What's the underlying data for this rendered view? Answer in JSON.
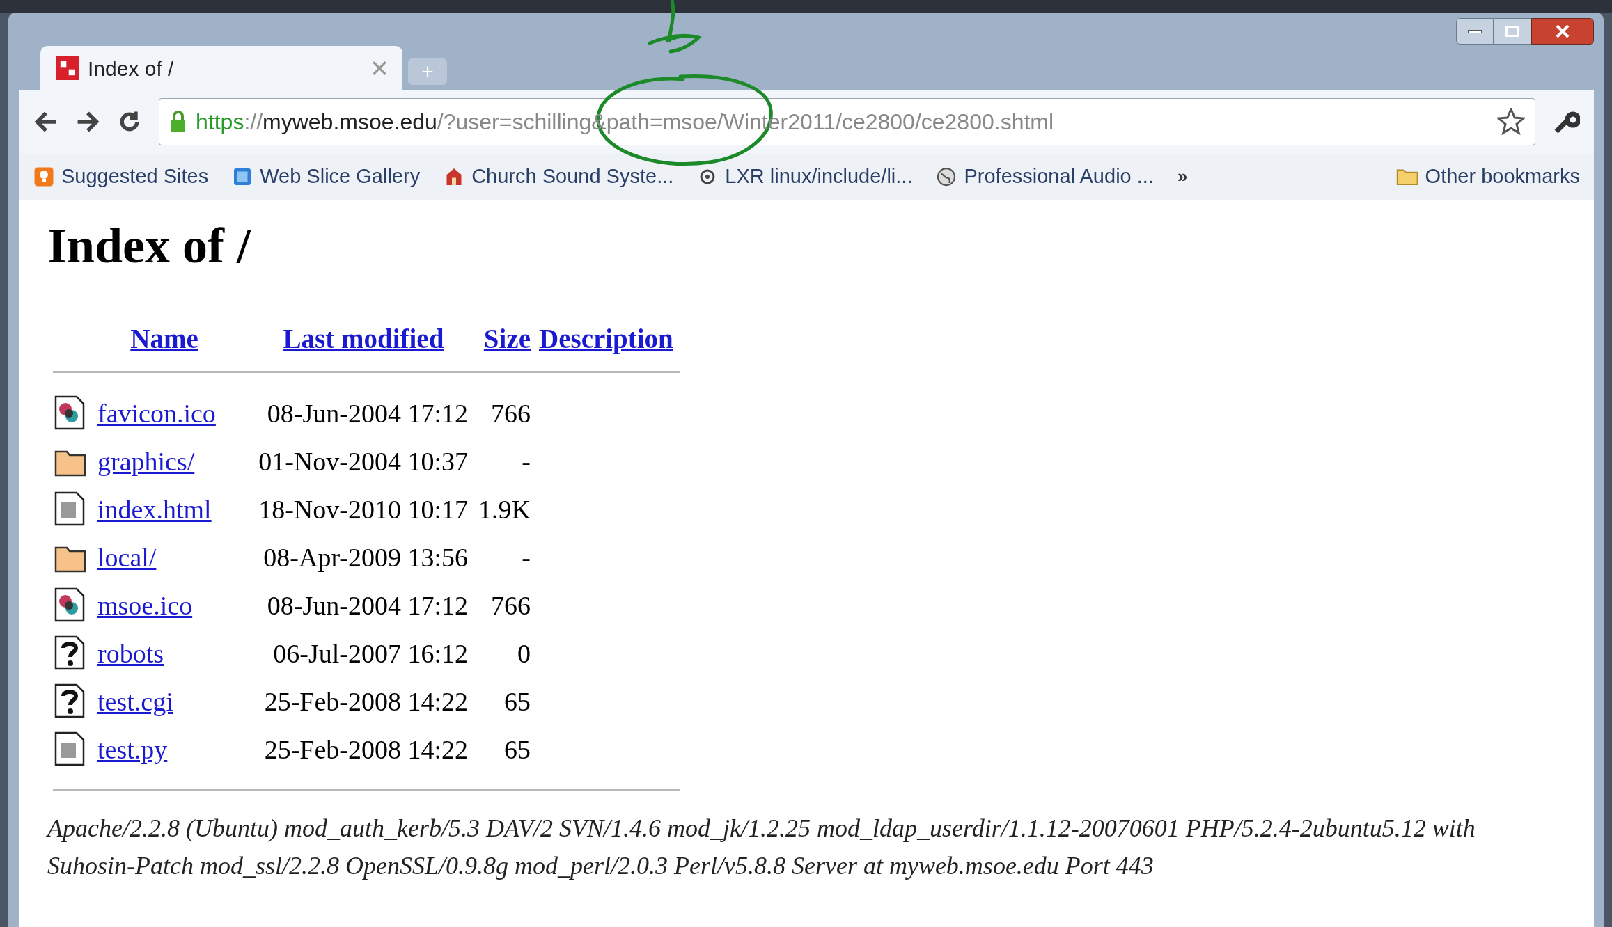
{
  "window": {
    "tabs": [
      {
        "title": "Index of /",
        "selected": true
      }
    ],
    "new_tab": "+"
  },
  "address_bar": {
    "scheme": "https",
    "separator": "://",
    "host": "myweb.msoe.edu",
    "path": "/?user=schilling&path=msoe/Winter2011/ce2800/ce2800.shtml"
  },
  "bookmarks": [
    {
      "kind": "bulb",
      "label": "Suggested Sites"
    },
    {
      "kind": "slice",
      "label": "Web Slice Gallery"
    },
    {
      "kind": "church",
      "label": "Church Sound Syste..."
    },
    {
      "kind": "lxr",
      "label": "LXR linux/include/li..."
    },
    {
      "kind": "globe",
      "label": "Professional Audio ..."
    }
  ],
  "bookmarks_overflow": "»",
  "other_bookmarks": "Other bookmarks",
  "page": {
    "heading": "Index of /",
    "columns": [
      "Name",
      "Last modified",
      "Size",
      "Description"
    ],
    "rows": [
      {
        "kind": "image",
        "name": "favicon.ico",
        "modified": "08-Jun-2004 17:12",
        "size": "766"
      },
      {
        "kind": "folder",
        "name": "graphics/",
        "modified": "01-Nov-2004 10:37",
        "size": "-"
      },
      {
        "kind": "text",
        "name": "index.html",
        "modified": "18-Nov-2010 10:17",
        "size": "1.9K"
      },
      {
        "kind": "folder",
        "name": "local/",
        "modified": "08-Apr-2009 13:56",
        "size": "-"
      },
      {
        "kind": "image",
        "name": "msoe.ico",
        "modified": "08-Jun-2004 17:12",
        "size": "766"
      },
      {
        "kind": "unknown",
        "name": "robots",
        "modified": "06-Jul-2007 16:12",
        "size": "0"
      },
      {
        "kind": "unknown",
        "name": "test.cgi",
        "modified": "25-Feb-2008 14:22",
        "size": "65"
      },
      {
        "kind": "text",
        "name": "test.py",
        "modified": "25-Feb-2008 14:22",
        "size": "65"
      }
    ],
    "footer": "Apache/2.2.8 (Ubuntu) mod_auth_kerb/5.3 DAV/2 SVN/1.4.6 mod_jk/1.2.25 mod_ldap_userdir/1.1.12-20070601 PHP/5.2.4-2ubuntu5.12 with Suhosin-Patch mod_ssl/2.2.8 OpenSSL/0.9.8g mod_perl/2.0.3 Perl/v5.8.8 Server at myweb.msoe.edu Port 443"
  },
  "annotation": {
    "kind": "circle-arrow"
  }
}
